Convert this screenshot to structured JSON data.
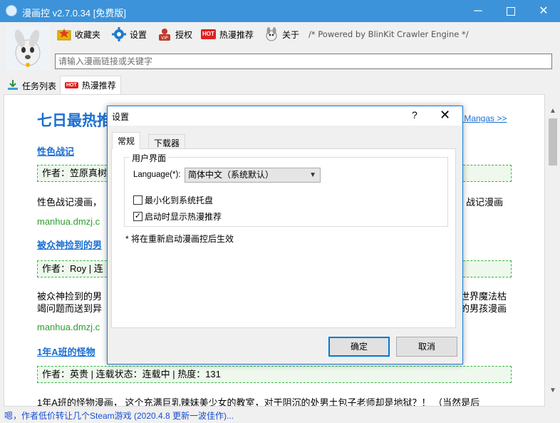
{
  "window": {
    "title": "漫画控 v2.7.0.34 [免费版]",
    "minimize_icon": "minimize-icon",
    "maximize_icon": "maximize-icon",
    "close_icon": "close-icon"
  },
  "toolbar": {
    "items": [
      {
        "label": "收藏夹",
        "icon": "favorites-icon"
      },
      {
        "label": "设置",
        "icon": "gear-icon"
      },
      {
        "label": "授权",
        "icon": "vip-icon"
      },
      {
        "label": "热漫推荐",
        "icon": "hot-icon",
        "badge": "HOT"
      },
      {
        "label": "关于",
        "icon": "about-icon"
      }
    ],
    "powered_by": "/* Powered by BlinKit Crawler Engine */"
  },
  "search": {
    "placeholder": "请输入漫画链接或关键字"
  },
  "tabs": [
    {
      "label": "任务列表",
      "icon": "download-icon"
    },
    {
      "label": "热漫推荐",
      "icon": "hot-icon",
      "badge": "HOT",
      "active": true
    }
  ],
  "content": {
    "title": "七日最热推",
    "right_link": "ot Mangas >>",
    "items": [
      {
        "heading": "性色战记",
        "meta": "作者：笠原真树",
        "desc_left": "性色战记漫画，",
        "desc_right": "战记漫画",
        "url": "manhua.dmzj.c"
      },
      {
        "heading": "被众神捡到的男",
        "meta": "作者：Roy | 连",
        "desc_left": "被众神捡到的男",
        "desc_left2": "竭问题而送到异",
        "desc_right": "世界魔法枯",
        "desc_right2": "的男孩漫画",
        "url": "manhua.dmzj.c"
      },
      {
        "heading": "1年A班的怪物",
        "meta": "作者：英贵 | 连载状态：连载中 | 热度：131",
        "desc": "1年A班的怪物漫画， 这个充满巨乳辣妹美少女的教室，对于阴沉的处男土包子老师却是地狱？！ （当然是后"
      }
    ]
  },
  "status": {
    "text": "嗯，作者低价转让几个Steam游戏 (2020.4.8 更新一波佳作)..."
  },
  "dialog": {
    "title": "设置",
    "help_icon": "?",
    "close_icon": "✕",
    "tabs": [
      "常规",
      "下载器"
    ],
    "group_label": "用户界面",
    "language_label": "Language(*):",
    "language_value": "简体中文（系统默认）",
    "options": [
      {
        "label": "最小化到系统托盘",
        "checked": false
      },
      {
        "label": "启动时显示热漫推荐",
        "checked": true
      }
    ],
    "note": "* 将在重新启动漫画控后生效",
    "ok_label": "确定",
    "cancel_label": "取消"
  }
}
